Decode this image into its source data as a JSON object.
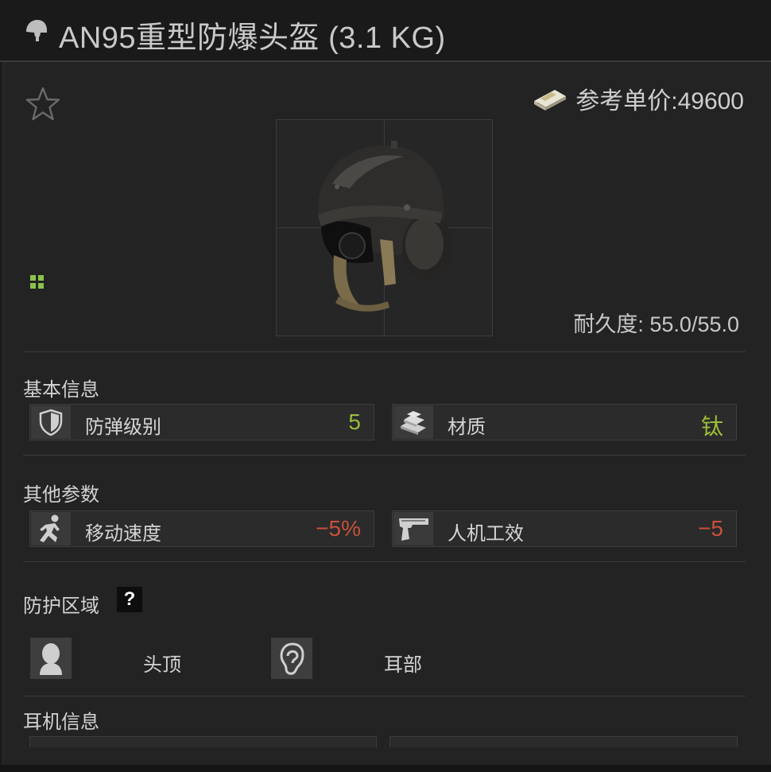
{
  "window": {
    "title": "AN95重型防爆头盔 (3.1 KG)",
    "title_icon": "helmet-icon"
  },
  "item": {
    "favorite_icon": "star-outline-icon",
    "price_icon": "money-stack-icon",
    "price_label": "参考单价:49600",
    "image_subject": "heavy helmet with ear protection",
    "size_icon": "grid-size-icon",
    "durability_label": "耐久度: 55.0/55.0"
  },
  "basic_info": {
    "title": "基本信息",
    "stats": [
      {
        "icon": "shield-icon",
        "label": "防弹级别",
        "value": "5",
        "color": "#9bbd3a"
      },
      {
        "icon": "ingots-icon",
        "label": "材质",
        "value": "钛",
        "color": "#9bbd3a"
      }
    ]
  },
  "other_params": {
    "title": "其他参数",
    "stats": [
      {
        "icon": "running-person-icon",
        "label": "移动速度",
        "value": "−5%",
        "color": "#c8503a"
      },
      {
        "icon": "pistol-icon",
        "label": "人机工效",
        "value": "−5",
        "color": "#c8503a"
      }
    ]
  },
  "protection": {
    "title": "防护区域",
    "help_label": "?",
    "zones": [
      {
        "icon": "head-top-icon",
        "label": "头顶"
      },
      {
        "icon": "ear-icon",
        "label": "耳部"
      }
    ]
  },
  "headset_info": {
    "title": "耳机信息"
  }
}
